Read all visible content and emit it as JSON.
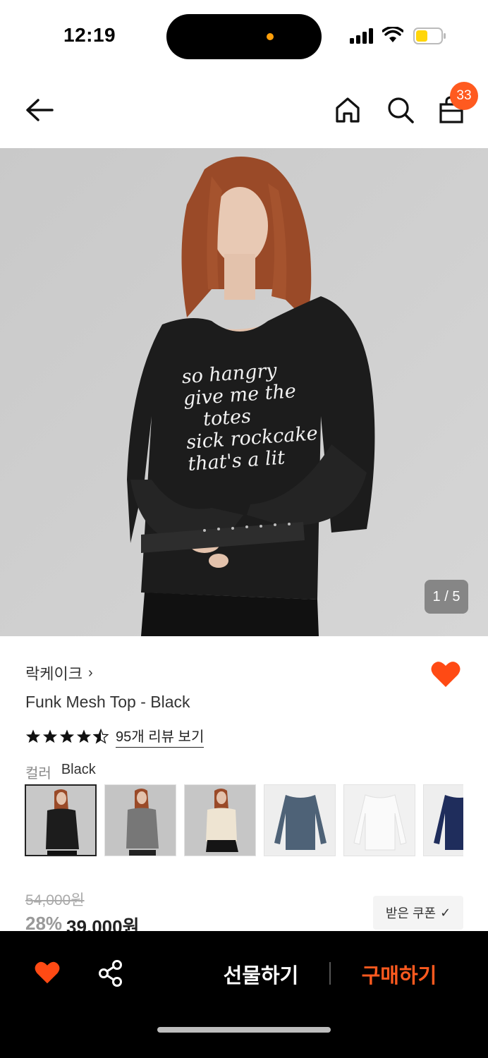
{
  "status_bar": {
    "time": "12:19"
  },
  "nav": {
    "cart_count": "33"
  },
  "icons": {
    "back": "back-arrow-icon",
    "home": "home-icon",
    "search": "search-icon",
    "cart": "shopping-bag-icon",
    "like": "heart-icon",
    "share": "share-icon"
  },
  "gallery": {
    "page_indicator": "1 / 5",
    "shirt_print_lines": [
      "so hangry",
      "give me the",
      "totes",
      "sick rockcake",
      "that's a lit"
    ]
  },
  "product": {
    "brand": "락케이크",
    "brand_chevron": "›",
    "name": "Funk Mesh Top - Black",
    "rating": 4.5,
    "rating_max": 5,
    "review_link": "95개 리뷰 보기",
    "color_label": "컬러",
    "color_value": "Black",
    "swatches": [
      {
        "color": "Black",
        "selected": true
      },
      {
        "color": "Gray",
        "selected": false
      },
      {
        "color": "Cream",
        "selected": false
      },
      {
        "color": "Slate Blue",
        "selected": false
      },
      {
        "color": "White",
        "selected": false
      },
      {
        "color": "Navy",
        "selected": false
      }
    ],
    "original_price": "54,000원",
    "discount": "28%",
    "price": "39,000원",
    "coupon_label": "받은 쿠폰",
    "coupon_check": "✓"
  },
  "bottom_bar": {
    "gift_label": "선물하기",
    "buy_label": "구매하기"
  },
  "colors": {
    "accent": "#ff5a1f",
    "liked": "#ff4a14",
    "hero_bg": "#cfcfcf",
    "bottom_bar_bg": "#000000"
  }
}
